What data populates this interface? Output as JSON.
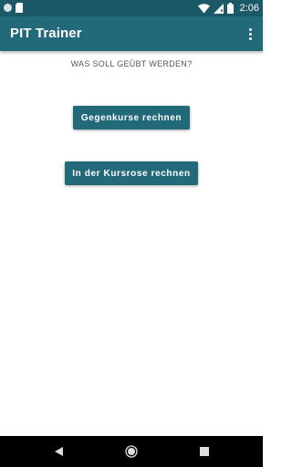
{
  "status_bar": {
    "time": "2:06",
    "icons": [
      "notification-dot-icon",
      "sd-card-icon",
      "wifi-icon",
      "signal-icon",
      "battery-icon"
    ],
    "background": "#1b5868"
  },
  "app_bar": {
    "title": "PIT Trainer",
    "background": "#22697a",
    "menu_icon": "more-vert-icon"
  },
  "main": {
    "question": "WAS SOLL GEÜBT WERDEN?",
    "buttons": [
      {
        "label": "Gegenkurse rechnen"
      },
      {
        "label": "In der Kursrose rechnen"
      }
    ],
    "button_color": "#22697a"
  },
  "nav_bar": {
    "items": [
      "back-icon",
      "home-icon",
      "recents-icon"
    ]
  }
}
